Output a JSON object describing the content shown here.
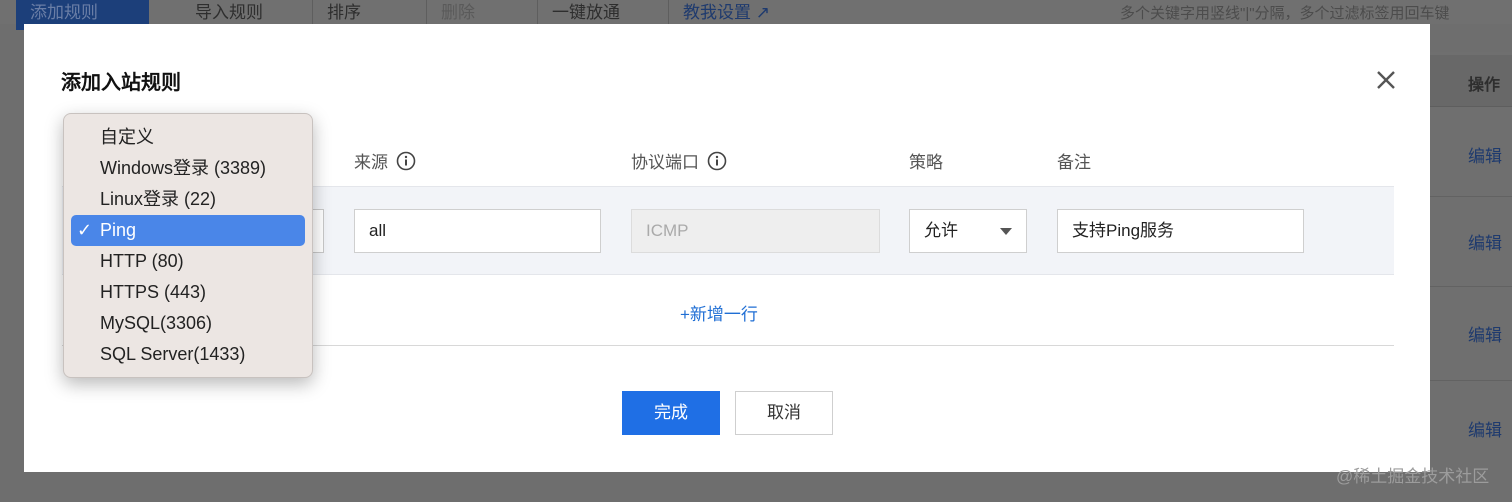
{
  "background": {
    "toolbar": {
      "add_rule": "添加规则",
      "import_rule": "导入规则",
      "sort": "排序",
      "delete": "删除",
      "one_click": "一键放通",
      "teach_me": "教我设置"
    },
    "search_placeholder": "多个关键字用竖线\"|\"分隔，多个过滤标签用回车键",
    "table_header_action": "操作",
    "edit_links": [
      "编辑",
      "编辑",
      "编辑",
      "编辑"
    ]
  },
  "modal": {
    "title": "添加入站规则",
    "columns": {
      "source": "来源",
      "protocol_port": "协议端口",
      "policy": "策略",
      "remark": "备注"
    },
    "row": {
      "source_value": "all",
      "protocol_port_value": "ICMP",
      "policy_value": "允许",
      "remark_value": "支持Ping服务"
    },
    "add_row": "+新增一行",
    "confirm": "完成",
    "cancel": "取消"
  },
  "dropdown": {
    "items": [
      {
        "label": "自定义",
        "selected": false
      },
      {
        "label": "Windows登录 (3389)",
        "selected": false
      },
      {
        "label": "Linux登录 (22)",
        "selected": false
      },
      {
        "label": "Ping",
        "selected": true
      },
      {
        "label": "HTTP (80)",
        "selected": false
      },
      {
        "label": "HTTPS (443)",
        "selected": false
      },
      {
        "label": "MySQL(3306)",
        "selected": false
      },
      {
        "label": "SQL Server(1433)",
        "selected": false
      }
    ],
    "check_mark": "✓"
  },
  "watermark": "@稀土掘金技术社区",
  "colors": {
    "primary": "#1f6fe5",
    "link": "#1f6ed4",
    "menu_selected": "#4a86e8"
  }
}
